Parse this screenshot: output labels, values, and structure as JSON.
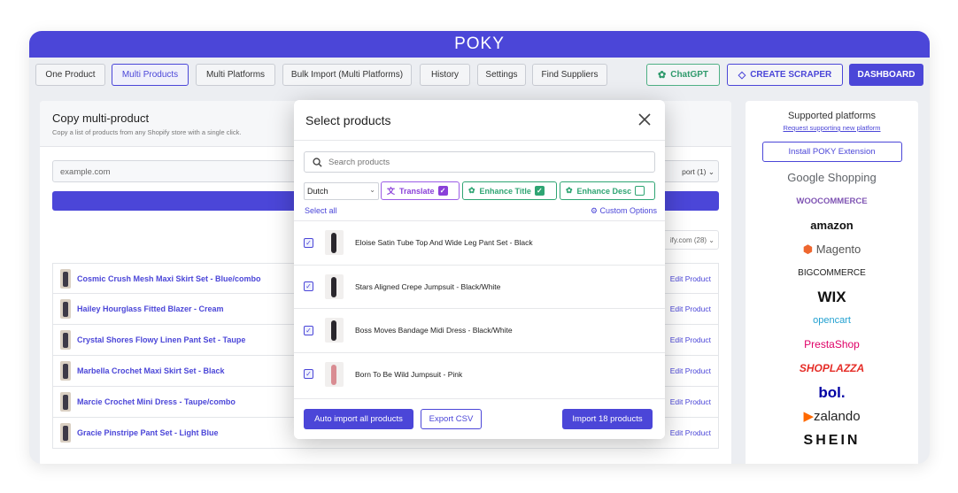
{
  "app": {
    "logo": "POKY"
  },
  "nav": {
    "items": [
      "One Product",
      "Multi Products",
      "Multi Platforms",
      "Bulk Import (Multi Platforms)",
      "History",
      "Settings",
      "Find Suppliers"
    ],
    "chatgpt": "ChatGPT",
    "create_scraper": "CREATE SCRAPER",
    "dashboard": "DASHBOARD"
  },
  "main": {
    "title": "Copy multi-product",
    "subtitle": "Copy a list of products from any Shopify store with a single click.",
    "url_placeholder": "example.com",
    "import_select": "port (1)",
    "store_select": "ify.com (28)",
    "edit_label": "Edit Product",
    "rows": [
      "Cosmic Crush Mesh Maxi Skirt Set - Blue/combo",
      "Hailey Hourglass Fitted Blazer - Cream",
      "Crystal Shores Flowy Linen Pant Set - Taupe",
      "Marbella Crochet Maxi Skirt Set - Black",
      "Marcie Crochet Mini Dress - Taupe/combo",
      "Gracie Pinstripe Pant Set - Light Blue"
    ]
  },
  "side": {
    "title": "Supported platforms",
    "link": "Request supporting new platform",
    "install": "Install POKY Extension",
    "platforms": [
      "Google Shopping",
      "WOOCOMMERCE",
      "amazon",
      "Magento",
      "BIGCOMMERCE",
      "WIX",
      "opencart",
      "PrestaShop",
      "SHOPLAZZA",
      "bol.",
      "zalando",
      "SHEIN"
    ]
  },
  "modal": {
    "title": "Select products",
    "search_placeholder": "Search products",
    "language": "Dutch",
    "translate": "Translate",
    "enhance_title": "Enhance Title",
    "enhance_desc": "Enhance Desc",
    "select_all": "Select all",
    "custom_options": "Custom Options",
    "products": [
      "Eloise Satin Tube Top And Wide Leg Pant Set - Black",
      "Stars Aligned Crepe Jumpsuit - Black/White",
      "Boss Moves Bandage Midi Dress - Black/White",
      "Born To Be Wild Jumpsuit - Pink"
    ],
    "auto_import": "Auto import all products",
    "export_csv": "Export CSV",
    "import_btn": "Import 18 products"
  }
}
